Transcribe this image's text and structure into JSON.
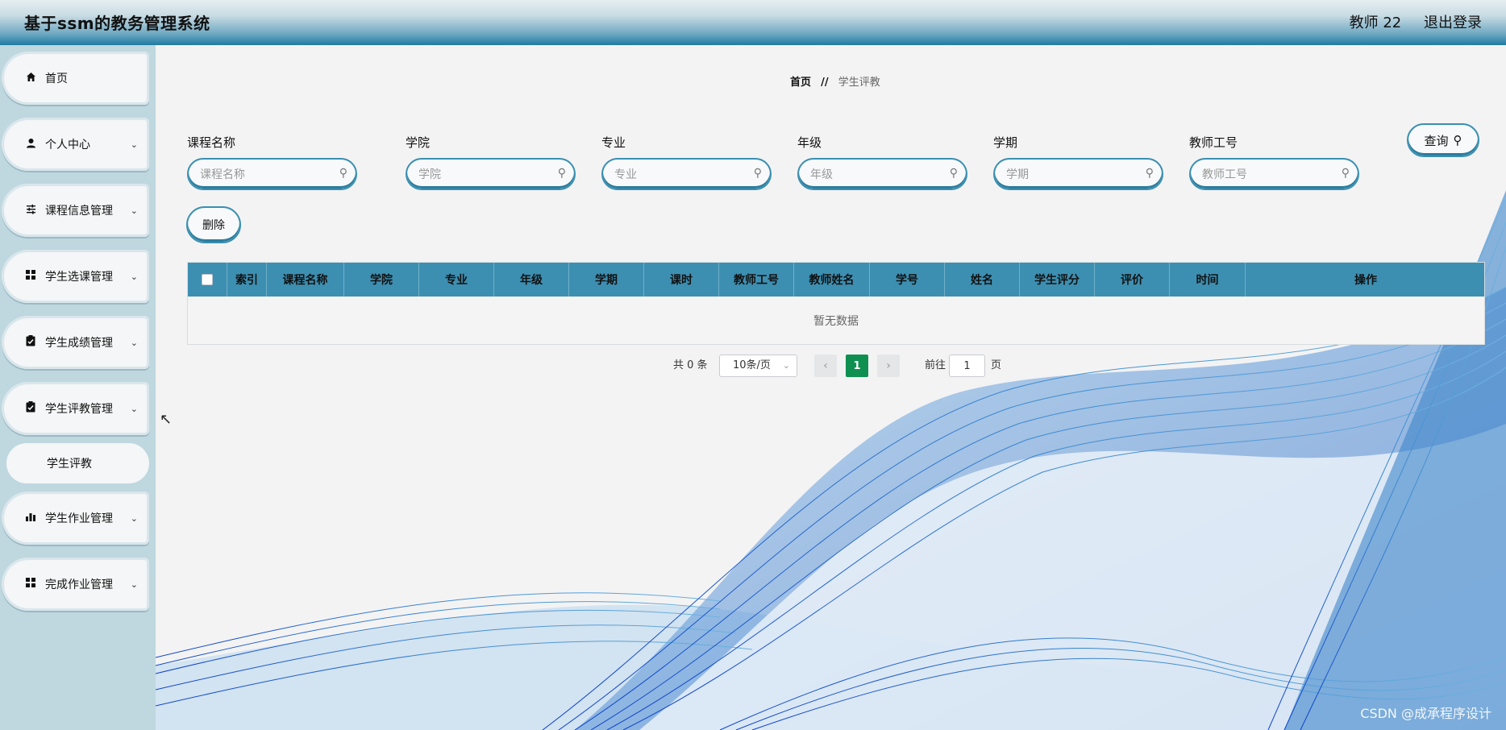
{
  "header": {
    "app_title": "基于ssm的教务管理系统",
    "user_name": "教师 22",
    "logout_label": "退出登录"
  },
  "sidebar": {
    "items": [
      {
        "label": "首页",
        "icon": "home-icon",
        "expandable": false
      },
      {
        "label": "个人中心",
        "icon": "user-icon",
        "expandable": true
      },
      {
        "label": "课程信息管理",
        "icon": "sliders-icon",
        "expandable": true
      },
      {
        "label": "学生选课管理",
        "icon": "grid-icon",
        "expandable": true
      },
      {
        "label": "学生成绩管理",
        "icon": "clipboard-icon",
        "expandable": true
      },
      {
        "label": "学生评教管理",
        "icon": "clipboard-icon",
        "expandable": true
      },
      {
        "label": "学生作业管理",
        "icon": "bar-chart-icon",
        "expandable": true
      },
      {
        "label": "完成作业管理",
        "icon": "grid-icon",
        "expandable": true
      }
    ],
    "active_submenu": "学生评教"
  },
  "breadcrumb": {
    "home": "首页",
    "separator": "//",
    "current": "学生评教"
  },
  "filters": [
    {
      "label": "课程名称",
      "placeholder": "课程名称"
    },
    {
      "label": "学院",
      "placeholder": "学院"
    },
    {
      "label": "专业",
      "placeholder": "专业"
    },
    {
      "label": "年级",
      "placeholder": "年级"
    },
    {
      "label": "学期",
      "placeholder": "学期"
    },
    {
      "label": "教师工号",
      "placeholder": "教师工号"
    }
  ],
  "actions": {
    "query_label": "查询",
    "delete_label": "删除"
  },
  "table": {
    "columns": [
      "索引",
      "课程名称",
      "学院",
      "专业",
      "年级",
      "学期",
      "课时",
      "教师工号",
      "教师姓名",
      "学号",
      "姓名",
      "学生评分",
      "评价",
      "时间",
      "操作"
    ],
    "rows": [],
    "empty_text": "暂无数据",
    "header_color": "#3d8fb1"
  },
  "pagination": {
    "total_text": "共 0 条",
    "page_size": "10条/页",
    "current_page": "1",
    "goto_label": "前往",
    "goto_value": "1",
    "goto_suffix": "页",
    "active_color": "#0f9050"
  },
  "watermark": "CSDN @成承程序设计"
}
